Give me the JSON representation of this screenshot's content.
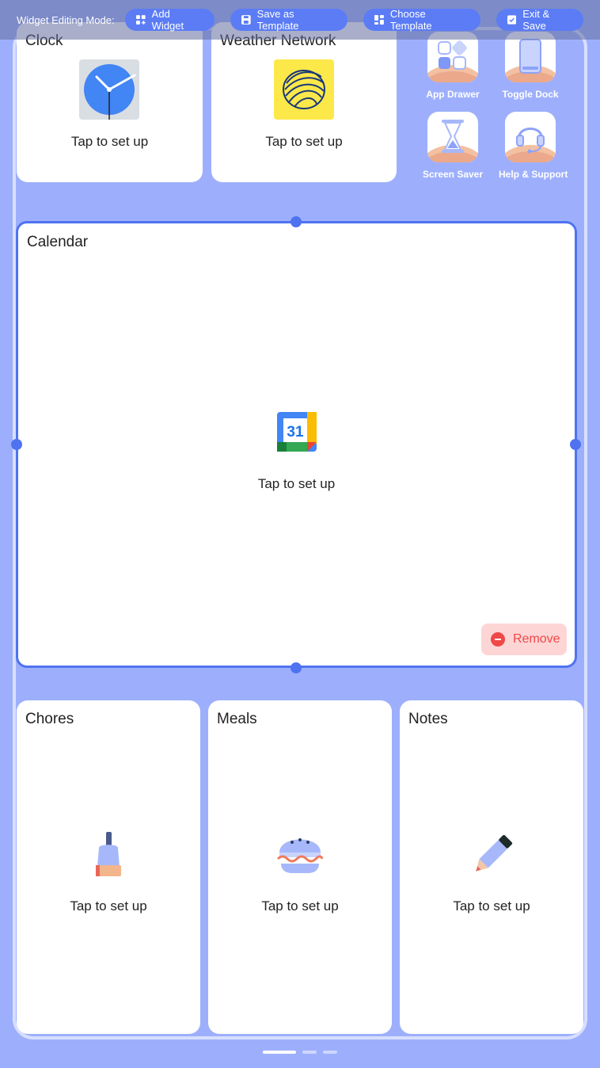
{
  "topbar": {
    "mode_label": "Widget Editing Mode:",
    "buttons": [
      {
        "label": "Add Widget",
        "icon": "grid-plus-icon"
      },
      {
        "label": "Save as Template",
        "icon": "save-icon"
      },
      {
        "label": "Choose Template",
        "icon": "grid-icon"
      },
      {
        "label": "Exit & Save",
        "icon": "check-icon"
      }
    ]
  },
  "widgets": {
    "clock": {
      "title": "Clock",
      "cta": "Tap to set up"
    },
    "weather": {
      "title": "Weather Network",
      "cta": "Tap to set up"
    },
    "calendar": {
      "title": "Calendar",
      "cta": "Tap to set up",
      "icon_text": "31",
      "remove_label": "Remove"
    },
    "chores": {
      "title": "Chores",
      "cta": "Tap to set up"
    },
    "meals": {
      "title": "Meals",
      "cta": "Tap to set up"
    },
    "notes": {
      "title": "Notes",
      "cta": "Tap to set up"
    }
  },
  "shortcuts": [
    {
      "label": "App Drawer",
      "icon": "app-drawer-icon"
    },
    {
      "label": "Toggle Dock",
      "icon": "toggle-dock-icon"
    },
    {
      "label": "Screen Saver",
      "icon": "hourglass-icon"
    },
    {
      "label": "Help & Support",
      "icon": "headset-icon"
    }
  ],
  "pager": {
    "pages": 3,
    "current": 1
  },
  "colors": {
    "background": "#9DAFFC",
    "accent": "#4F73F0",
    "button": "#5B7CF5",
    "remove": "#F04747"
  }
}
